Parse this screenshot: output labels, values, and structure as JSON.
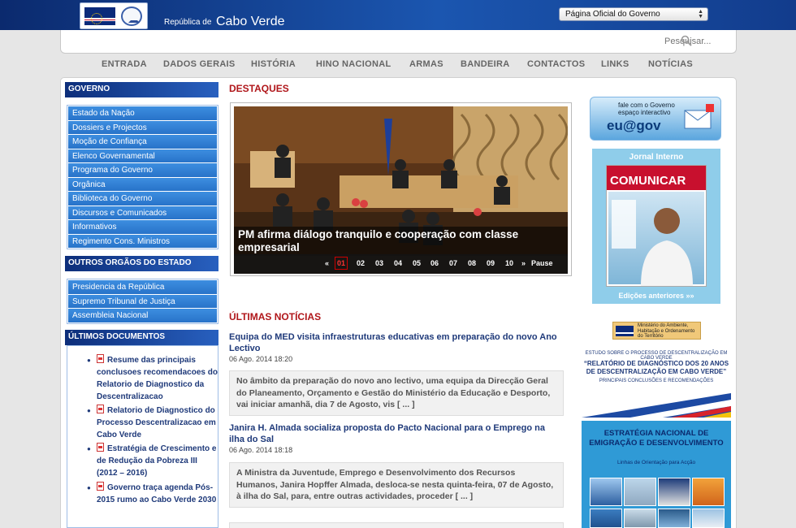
{
  "header": {
    "brand_prefix": "República de",
    "brand_name": "Cabo Verde",
    "gov_select": "Página Oficial do Governo",
    "search_placeholder": "Pesquisar..."
  },
  "nav": [
    "ENTRADA",
    "DADOS GERAIS",
    "HISTÓRIA",
    "HINO NACIONAL",
    "ARMAS",
    "BANDEIRA",
    "CONTACTOS",
    "LINKS",
    "NOTÍCIAS"
  ],
  "sidebar": {
    "gov_title": "GOVERNO",
    "gov_items": [
      "Estado da Nação",
      "Dossiers e Projectos",
      "Moção de Confiança",
      "Elenco Governamental",
      "Programa do Governo",
      "Orgânica",
      "Biblioteca do Governo",
      "Discursos e Comunicados",
      "Informativos",
      "Regimento Cons. Ministros"
    ],
    "orgs_title": "OUTROS ORGÃOS DO ESTADO",
    "orgs_items": [
      "Presidencia da República",
      "Supremo Tribunal de Justiça",
      "Assembleia Nacional"
    ],
    "docs_title": "ÚLTIMOS DOCUMENTOS",
    "docs": [
      "Resume das principais conclusoes recomendacoes do Relatorio de Diagnostico da Descentralizacao",
      "Relatorio de Diagnostico do Processo Descentralizacao em Cabo Verde",
      "Estratégia de Crescimento e de Redução da Pobreza III (2012 – 2016)",
      "Governo traça agenda Pós-2015 rumo ao Cabo Verde 2030"
    ]
  },
  "main": {
    "highlights_title": "DESTAQUES",
    "slide_caption": "PM afirma diálogo tranquilo e cooperação com classe empresarial",
    "pager": {
      "prev": "«",
      "pages": [
        "01",
        "02",
        "03",
        "04",
        "05",
        "06",
        "07",
        "08",
        "09",
        "10"
      ],
      "next": "»",
      "pause": "Pause",
      "current": "01"
    },
    "news_title": "ÚLTIMAS NOTÍCIAS",
    "news": [
      {
        "title": "Equipa do MED visita infraestruturas educativas em preparação do novo Ano Lectivo",
        "date": "06 Ago. 2014 18:20",
        "summary": "No âmbito da preparação do novo ano lectivo, uma equipa da Direcção Geral do Planeamento, Orçamento e Gestão do Ministério da Educação e Desporto, vai iniciar amanhã, dia 7 de Agosto, vis [ ... ]"
      },
      {
        "title": "Janira H. Almada socializa proposta do Pacto Nacional para o Emprego na ilha do Sal",
        "date": "06 Ago. 2014 18:18",
        "summary": "A Ministra da Juventude, Emprego e Desenvolvimento dos Recursos Humanos, Janira Hopffer Almada, desloca-se nesta quinta-feira, 07 de Agosto, à ilha do Sal, para, entre outras actividades, proceder  [ ... ]"
      }
    ]
  },
  "right": {
    "egov_line1": "fale com o Governo",
    "egov_line2": "espaço interactivo",
    "egov_brand": "eu@gov",
    "journal_title": "Jornal Interno",
    "journal_cover": "COMUNICAR",
    "journal_more": "Edições anteriores »»",
    "ministry_text": "Ministério do Ambiente, Habitação e Ordenamento do Território",
    "study_small": "ESTUDO SOBRE O PROCESSO DE DESCENTRALIZAÇÃO EM CABO VERDE",
    "study_title": "“RELATÓRIO DE DIAGNÓSTICO DOS 20 ANOS DE DESCENTRALIZAÇÃO EM CABO VERDE”",
    "study_sub": "PRINCIPAIS CONCLUSÕES E RECOMENDAÇÕES",
    "strategy_title": "ESTRATÉGIA NACIONAL DE EMIGRAÇÃO E DESENVOLVIMENTO",
    "strategy_sub": "Linhas de Orientação para Acção"
  }
}
